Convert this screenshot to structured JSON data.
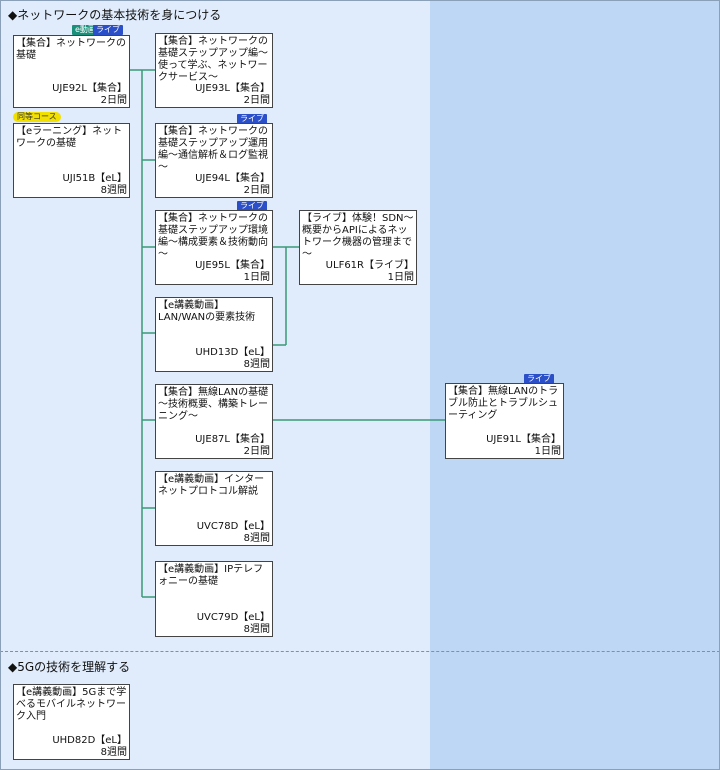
{
  "sections": [
    {
      "title": "◆ネットワークの基本技術を身につける"
    },
    {
      "title": "◆5Gの技術を理解する"
    }
  ],
  "courses": {
    "uje92l": {
      "title": "【集合】ネットワークの基礎",
      "code": "UJE92L【集合】",
      "duration": "2日間",
      "badges": [
        "e動画",
        "ライブ"
      ]
    },
    "uji51b": {
      "title": "【eラーニング】ネットワークの基礎",
      "code": "UJI51B【eL】",
      "duration": "8週間",
      "badges": [
        "同等コース"
      ]
    },
    "uje93l": {
      "title": "【集合】ネットワークの基礎ステップアップ編～使って学ぶ、ネットワークサービス～",
      "code": "UJE93L【集合】",
      "duration": "2日間"
    },
    "uje94l": {
      "title": "【集合】ネットワークの基礎ステップアップ運用編～通信解析＆ログ監視～",
      "code": "UJE94L【集合】",
      "duration": "2日間",
      "badges": [
        "ライブ"
      ]
    },
    "uje95l": {
      "title": "【集合】ネットワークの基礎ステップアップ環境編～構成要素＆技術動向～",
      "code": "UJE95L【集合】",
      "duration": "1日間",
      "badges": [
        "ライブ"
      ]
    },
    "ulf61r": {
      "title": "【ライブ】体験！SDN～概要からAPIによるネットワーク機器の管理まで～",
      "code": "ULF61R【ライブ】",
      "duration": "1日間"
    },
    "uhd13d": {
      "title": "【e講義動画】LAN/WANの要素技術",
      "code": "UHD13D【eL】",
      "duration": "8週間"
    },
    "uje87l": {
      "title": "【集合】無線LANの基礎～技術概要、構築トレーニング～",
      "code": "UJE87L【集合】",
      "duration": "2日間"
    },
    "uje91l": {
      "title": "【集合】無線LANのトラブル防止とトラブルシューティング",
      "code": "UJE91L【集合】",
      "duration": "1日間",
      "badges": [
        "ライブ"
      ]
    },
    "uvc78d": {
      "title": "【e講義動画】インターネットプロトコル解説",
      "code": "UVC78D【eL】",
      "duration": "8週間"
    },
    "uvc79d": {
      "title": "【e講義動画】IPテレフォニーの基礎",
      "code": "UVC79D【eL】",
      "duration": "8週間"
    },
    "uhd82d": {
      "title": "【e講義動画】5Gまで学べるモバイルネットワーク入門",
      "code": "UHD82D【eL】",
      "duration": "8週間"
    }
  },
  "colors": {
    "connector": "#3a9a78",
    "live_badge": "#2a4fc8",
    "edoga_badge": "#1c8f7a",
    "doto_badge": "#f2e000"
  }
}
